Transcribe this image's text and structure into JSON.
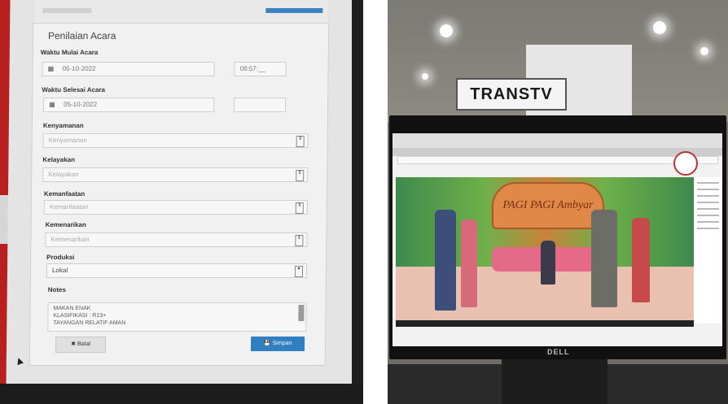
{
  "form": {
    "title": "Penilaian Acara",
    "start_label": "Waktu Mulai Acara",
    "start_date": "05-10-2022",
    "start_time": "08:57:__",
    "end_label": "Waktu Selesai Acara",
    "end_date": "05-10-2022",
    "end_time": "",
    "kenyamanan_label": "Kenyamanan",
    "kenyamanan_placeholder": "Kenyamanan",
    "kelayakan_label": "Kelayakan",
    "kelayakan_placeholder": "Kelayakan",
    "kemanfaatan_label": "Kemanfaatan",
    "kemanfaatan_placeholder": "Kemanfaatan",
    "kemenarikan_label": "Kemenarikan",
    "kemenarikan_placeholder": "Kemenarikan",
    "produksi_label": "Produksi",
    "produksi_value": "Lokal",
    "notes_label": "Notes",
    "notes_lines": [
      "MAKAN ENAK",
      "KLASIFIKASI : R13+",
      "TAYANGAN RELATIF AMAN"
    ],
    "cancel_label": "✖ Batal",
    "save_label": "💾 Simpan"
  },
  "studio": {
    "sign_text": "TRANSTV",
    "show_banner": "PAGI PAGI Ambyar",
    "brand": "DELL"
  },
  "colors": {
    "save_button": "#2f7fc1",
    "monitor_red": "#b81f1f",
    "sofa_pink": "#e46a88"
  }
}
